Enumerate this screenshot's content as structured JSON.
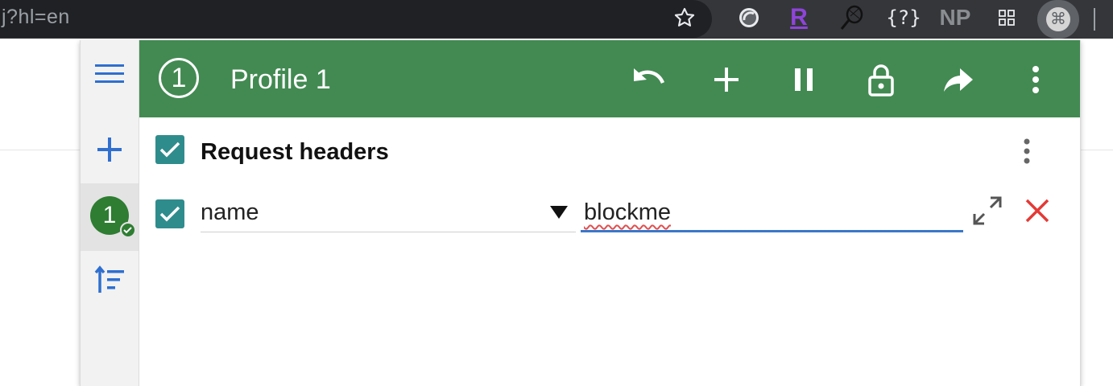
{
  "browser": {
    "url_fragment": "j?hl=en",
    "extensions": [
      "star-icon",
      "ghost-icon",
      "r-extension-icon",
      "tennis-icon",
      "json-icon",
      "np-extension-icon",
      "grid-icon",
      "command-icon"
    ],
    "ext_labels": {
      "json": "{?}",
      "np": "NP",
      "r": "R",
      "cmd": "⌘"
    }
  },
  "header": {
    "profile_number": "1",
    "profile_title": "Profile 1",
    "color": "#428a52"
  },
  "sidebar": {
    "profile_number": "1",
    "profile_color": "#2e7d32"
  },
  "section": {
    "title": "Request headers",
    "enabled": true
  },
  "header_row": {
    "enabled": true,
    "name": "name",
    "value": "blockme"
  }
}
